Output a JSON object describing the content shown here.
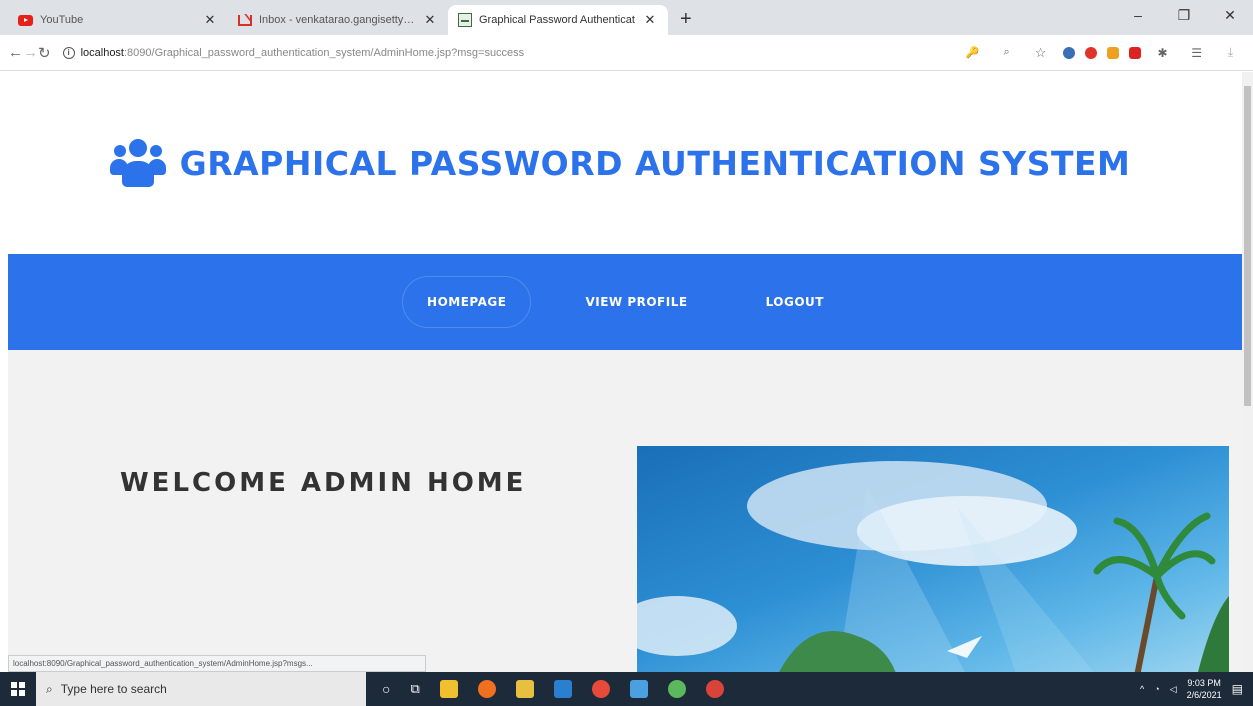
{
  "browser": {
    "tabs": [
      {
        "title": "YouTube",
        "icon": "youtube-icon"
      },
      {
        "title": "Inbox - venkatarao.gangisetty0…",
        "icon": "gmail-icon"
      },
      {
        "title": "Graphical Password Authenticat",
        "icon": "page-favicon-icon"
      }
    ],
    "address": {
      "host": "localhost",
      "path": ":8090/Graphical_password_authentication_system/AdminHome.jsp?msg=success"
    },
    "status_url": "localhost:8090/Graphical_password_authentication_system/AdminHome.jsp?msgs..."
  },
  "site": {
    "title": "GRAPHICAL PASSWORD AUTHENTICATION SYSTEM",
    "brand_color": "#2c72ea",
    "nav": [
      {
        "label": "HOMEPAGE",
        "active": true
      },
      {
        "label": "VIEW PROFILE",
        "active": false
      },
      {
        "label": "LOGOUT",
        "active": false
      }
    ],
    "welcome": "WELCOME ADMIN HOME"
  },
  "taskbar": {
    "search_placeholder": "Type here to search",
    "time": "9:03 PM",
    "date": "2/6/2021"
  }
}
